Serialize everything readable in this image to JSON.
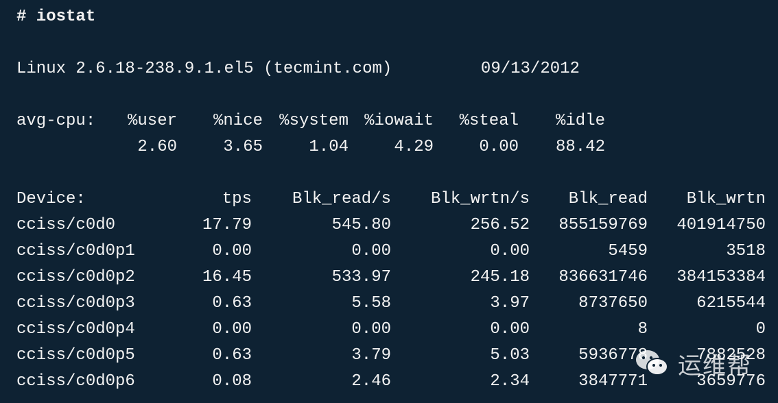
{
  "terminal": {
    "command": "# iostat",
    "system_line": "Linux 2.6.18-238.9.1.el5 (tecmint.com)         09/13/2012",
    "cpu": {
      "label": "avg-cpu:",
      "headers": [
        "%user",
        "%nice",
        "%system",
        "%iowait",
        "%steal",
        "%idle"
      ],
      "values": [
        "2.60",
        "3.65",
        "1.04",
        "4.29",
        "0.00",
        "88.42"
      ]
    },
    "devices": {
      "headers": [
        "Device:",
        "tps",
        "Blk_read/s",
        "Blk_wrtn/s",
        "Blk_read",
        "Blk_wrtn"
      ],
      "rows": [
        [
          "cciss/c0d0",
          "17.79",
          "545.80",
          "256.52",
          "855159769",
          "401914750"
        ],
        [
          "cciss/c0d0p1",
          "0.00",
          "0.00",
          "0.00",
          "5459",
          "3518"
        ],
        [
          "cciss/c0d0p2",
          "16.45",
          "533.97",
          "245.18",
          "836631746",
          "384153384"
        ],
        [
          "cciss/c0d0p3",
          "0.63",
          "5.58",
          "3.97",
          "8737650",
          "6215544"
        ],
        [
          "cciss/c0d0p4",
          "0.00",
          "0.00",
          "0.00",
          "8",
          "0"
        ],
        [
          "cciss/c0d0p5",
          "0.63",
          "3.79",
          "5.03",
          "5936778",
          "7882528"
        ],
        [
          "cciss/c0d0p6",
          "0.08",
          "2.46",
          "2.34",
          "3847771",
          "3659776"
        ]
      ]
    }
  },
  "watermark": {
    "text": "运维帮",
    "icon": "wechat-icon"
  },
  "colors": {
    "background": "#0e2233",
    "foreground": "#f2f2f2"
  }
}
